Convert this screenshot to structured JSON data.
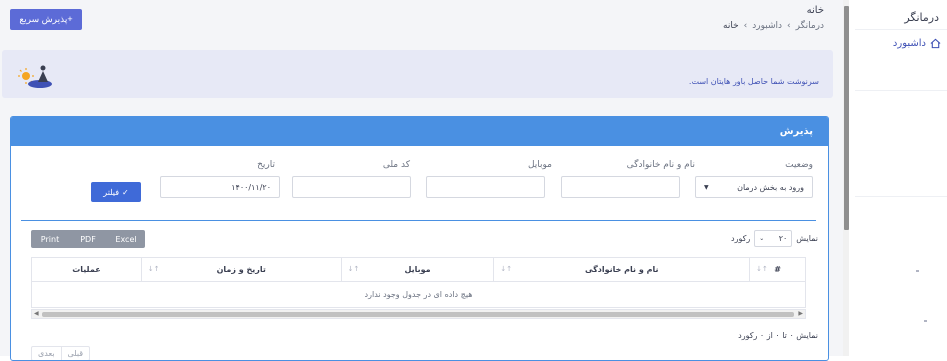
{
  "app": {
    "brand": "درمانگر"
  },
  "sidebar": {
    "items": [
      {
        "label": "داشبورد",
        "icon": "home-icon"
      }
    ]
  },
  "header": {
    "title": "خانه",
    "breadcrumb": [
      "درمانگر",
      "داشبورد",
      "خانه"
    ],
    "quick_button": "+پذیرش سریع"
  },
  "banner": {
    "text": "سرنوشت شما حاصل باور هایتان است."
  },
  "card": {
    "title": "پذیرش",
    "filters": {
      "status_label": "وضعیت",
      "status_value": "ورود به بخش درمان",
      "name_label": "نام و نام خانوادگی",
      "name_value": "",
      "mobile_label": "موبایل",
      "mobile_value": "",
      "national_id_label": "کد ملی",
      "national_id_value": "",
      "date_label": "تاریخ",
      "date_value": "۱۴۰۰/۱۱/۲۰",
      "filter_button": "فیلتر"
    },
    "exports": [
      "Excel",
      "PDF",
      "Print"
    ],
    "show": {
      "prefix": "نمایش",
      "value": "۲۰",
      "suffix": "رکورد"
    },
    "table": {
      "columns": [
        "#",
        "نام و نام خانوادگی",
        "موبایل",
        "تاریخ و زمان",
        "عملیات"
      ],
      "empty": "هیچ داده ای در جدول وجود ندارد"
    },
    "info": "نمایش ۰ تا ۰ از ۰ رکورد",
    "pager": {
      "prev": "قبلی",
      "next": "بعدی"
    }
  },
  "colors": {
    "primary": "#3f51b5",
    "header_blue": "#4a90e2",
    "button": "#5c6bd7"
  }
}
